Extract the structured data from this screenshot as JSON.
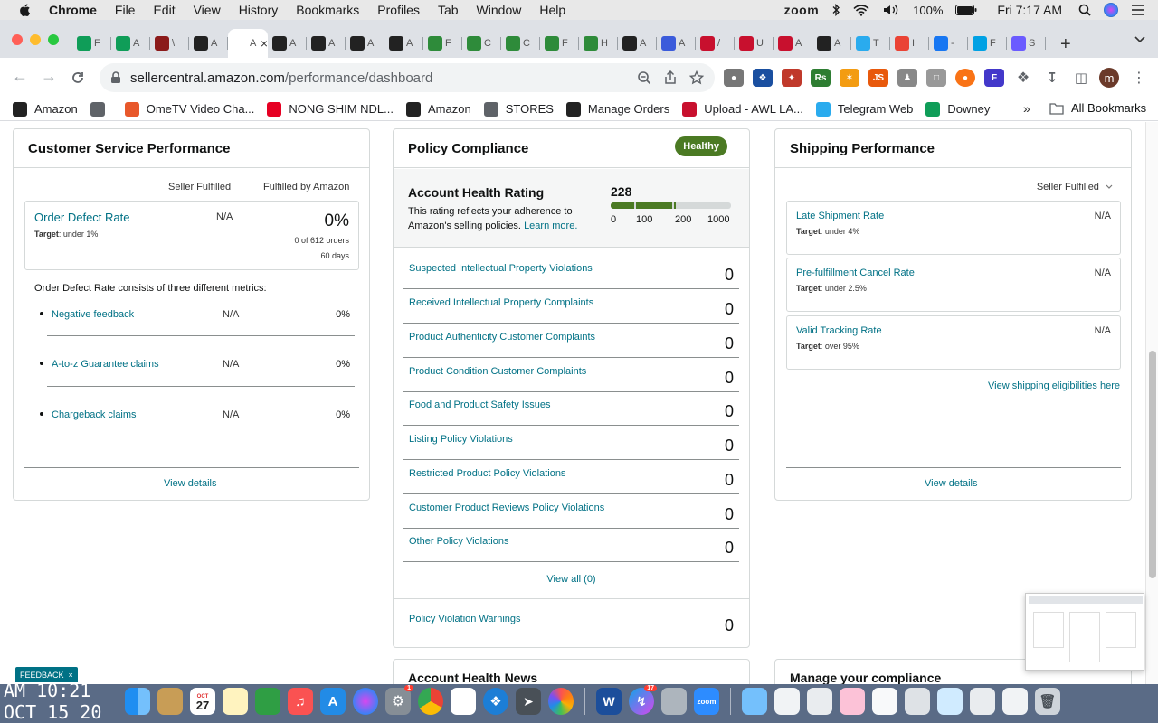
{
  "menubar": {
    "app": "Chrome",
    "items": [
      "File",
      "Edit",
      "View",
      "History",
      "Bookmarks",
      "Profiles",
      "Tab",
      "Window",
      "Help"
    ],
    "zoom": "zoom",
    "battery": "100%",
    "clock": "Fri 7:17 AM"
  },
  "tabs": [
    {
      "label": "F",
      "color": "#0f9d58",
      "active": false
    },
    {
      "label": "A",
      "color": "#0f9d58",
      "active": false
    },
    {
      "label": "\\",
      "color": "#8b1a1a",
      "active": false
    },
    {
      "label": "A",
      "color": "#222222",
      "active": false
    },
    {
      "label": "A",
      "color": "#ffffff",
      "active": true
    },
    {
      "label": "A",
      "color": "#222222",
      "active": false
    },
    {
      "label": "A",
      "color": "#222222",
      "active": false
    },
    {
      "label": "A",
      "color": "#222222",
      "active": false
    },
    {
      "label": "A",
      "color": "#222222",
      "active": false
    },
    {
      "label": "F",
      "color": "#2e8b3a",
      "active": false
    },
    {
      "label": "C",
      "color": "#2e8b3a",
      "active": false
    },
    {
      "label": "C",
      "color": "#2e8b3a",
      "active": false
    },
    {
      "label": "F",
      "color": "#2e8b3a",
      "active": false
    },
    {
      "label": "H",
      "color": "#2e8b3a",
      "active": false
    },
    {
      "label": "A",
      "color": "#222222",
      "active": false
    },
    {
      "label": "A",
      "color": "#3b5bdb",
      "active": false
    },
    {
      "label": "/",
      "color": "#c8102e",
      "active": false
    },
    {
      "label": "U",
      "color": "#c8102e",
      "active": false
    },
    {
      "label": "A",
      "color": "#c8102e",
      "active": false
    },
    {
      "label": "A",
      "color": "#222222",
      "active": false
    },
    {
      "label": "T",
      "color": "#2aabee",
      "active": false
    },
    {
      "label": "I",
      "color": "#ea4335",
      "active": false
    },
    {
      "label": "-",
      "color": "#1877f2",
      "active": false
    },
    {
      "label": "F",
      "color": "#00a1e4",
      "active": false
    },
    {
      "label": "S",
      "color": "#6b5bff",
      "active": false
    }
  ],
  "active_tab_close": "×",
  "address": {
    "host": "sellercentral.amazon.com",
    "path": "/performance/dashboard"
  },
  "bookmarks": [
    {
      "label": "Amazon",
      "icon": "amazon-icon",
      "color": "#222222"
    },
    {
      "label": "",
      "icon": "globe-icon",
      "color": "#5f6368"
    },
    {
      "label": "OmeTV Video Cha...",
      "icon": "ometv-icon",
      "color": "#e8582b"
    },
    {
      "label": "NONG SHIM NDL...",
      "icon": "pinterest-icon",
      "color": "#e60023"
    },
    {
      "label": "Amazon",
      "icon": "amazon-icon",
      "color": "#222222"
    },
    {
      "label": "STORES",
      "icon": "folder-icon",
      "color": "#5f6368"
    },
    {
      "label": "Manage Orders",
      "icon": "amazon-icon",
      "color": "#222222"
    },
    {
      "label": "Upload - AWL LA...",
      "icon": "awl-icon",
      "color": "#c8102e"
    },
    {
      "label": "Telegram Web",
      "icon": "telegram-icon",
      "color": "#2aabee"
    },
    {
      "label": "Downey",
      "icon": "sheets-icon",
      "color": "#0f9d58"
    }
  ],
  "all_bookmarks": "All Bookmarks",
  "customer_service": {
    "title": "Customer Service Performance",
    "col_seller": "Seller Fulfilled",
    "col_fba": "Fulfilled by Amazon",
    "odr_title": "Order Defect Rate",
    "odr_target_label": "Target",
    "odr_target_value": ": under 1%",
    "odr_seller": "N/A",
    "odr_pct": "0%",
    "odr_orders": "0 of 612 orders",
    "odr_days": "60 days",
    "sub_heading": "Order Defect Rate consists of three different metrics:",
    "metrics": [
      {
        "name": "Negative feedback",
        "seller": "N/A",
        "fba": "0%"
      },
      {
        "name": "A-to-z Guarantee claims",
        "seller": "N/A",
        "fba": "0%"
      },
      {
        "name": "Chargeback claims",
        "seller": "N/A",
        "fba": "0%"
      }
    ],
    "view_details": "View details"
  },
  "policy": {
    "title": "Policy Compliance",
    "badge": "Healthy",
    "ahr_title": "Account Health Rating",
    "ahr_desc": "This rating reflects your adherence to Amazon's selling policies.",
    "learn_more": "Learn more.",
    "score": "228",
    "score_value": 228,
    "ticks": [
      "0",
      "100",
      "200",
      "1000"
    ],
    "rows": [
      {
        "label": "Suspected Intellectual Property Violations",
        "value": "0"
      },
      {
        "label": "Received Intellectual Property Complaints",
        "value": "0"
      },
      {
        "label": "Product Authenticity Customer Complaints",
        "value": "0"
      },
      {
        "label": "Product Condition Customer Complaints",
        "value": "0"
      },
      {
        "label": "Food and Product Safety Issues",
        "value": "0"
      },
      {
        "label": "Listing Policy Violations",
        "value": "0"
      },
      {
        "label": "Restricted Product Policy Violations",
        "value": "0"
      },
      {
        "label": "Customer Product Reviews Policy Violations",
        "value": "0"
      },
      {
        "label": "Other Policy Violations",
        "value": "0"
      }
    ],
    "view_all": "View all (0)",
    "warnings_label": "Policy Violation Warnings",
    "warnings_value": "0"
  },
  "shipping": {
    "title": "Shipping Performance",
    "selector": "Seller Fulfilled",
    "metrics": [
      {
        "name": "Late Shipment Rate",
        "target_label": "Target",
        "target_value": ": under 4%",
        "value": "N/A"
      },
      {
        "name": "Pre-fulfillment Cancel Rate",
        "target_label": "Target",
        "target_value": ": under 2.5%",
        "value": "N/A"
      },
      {
        "name": "Valid Tracking Rate",
        "target_label": "Target",
        "target_value": ": over 95%",
        "value": "N/A"
      }
    ],
    "eligibility_link": "View shipping eligibilities here",
    "view_details": "View details"
  },
  "below_cards": {
    "news": "Account Health News",
    "manage": "Manage your compliance"
  },
  "feedback": "FEEDBACK",
  "feedback_close": "×",
  "overlay_clock": {
    "line1": "AM 10:21",
    "line2": "OCT 15 20"
  },
  "dock": {
    "calendar_month": "OCT",
    "calendar_day": "27",
    "settings_badge": "1",
    "messenger_badge": "17",
    "zoom_label": "zoom"
  }
}
